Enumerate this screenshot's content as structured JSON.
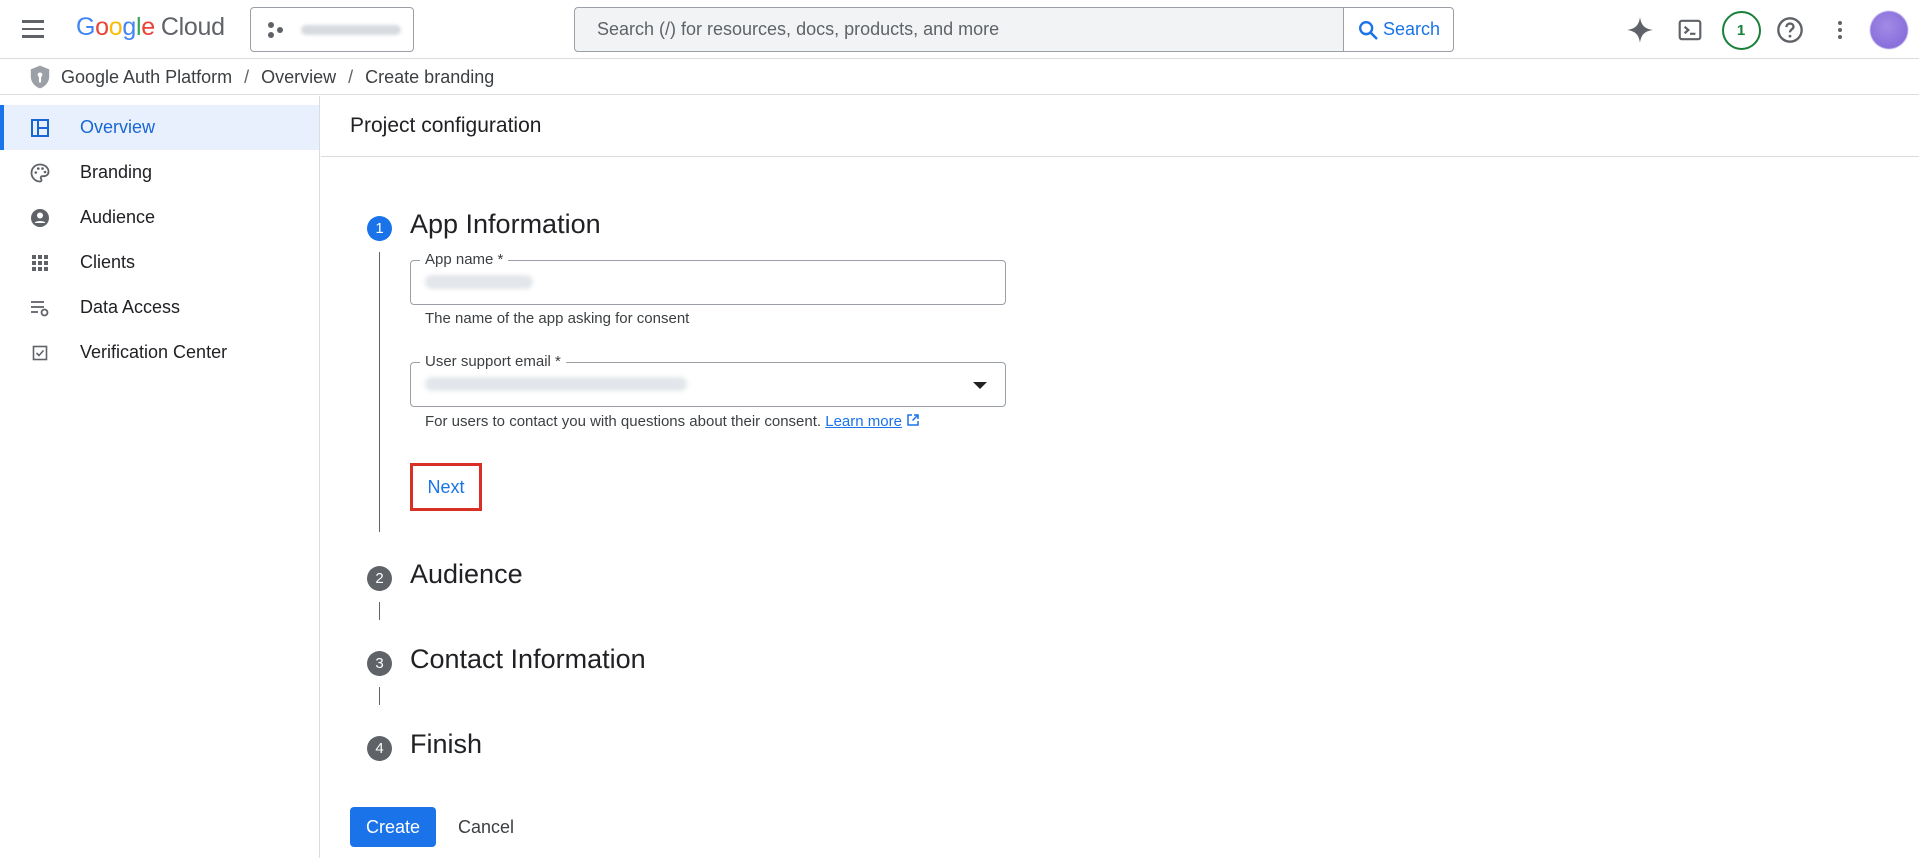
{
  "header": {
    "logo_google": [
      "G",
      "o",
      "o",
      "g",
      "l",
      "e"
    ],
    "logo_cloud": "Cloud",
    "search_placeholder": "Search (/) for resources, docs, products, and more",
    "search_button": "Search",
    "notifications_count": "1",
    "icons": [
      "menu-icon",
      "gemini-sparkle-icon",
      "cloud-shell-terminal-icon",
      "help-icon",
      "more-vert-icon"
    ]
  },
  "breadcrumb": {
    "items": [
      "Google Auth Platform",
      "Overview",
      "Create branding"
    ],
    "separator": "/"
  },
  "sidebar": {
    "items": [
      {
        "label": "Overview",
        "icon": "overview-dashboard-icon",
        "active": true
      },
      {
        "label": "Branding",
        "icon": "palette-icon",
        "active": false
      },
      {
        "label": "Audience",
        "icon": "account-circle-icon",
        "active": false
      },
      {
        "label": "Clients",
        "icon": "apps-grid-icon",
        "active": false
      },
      {
        "label": "Data Access",
        "icon": "data-access-list-icon",
        "active": false
      },
      {
        "label": "Verification Center",
        "icon": "checkbox-icon",
        "active": false
      }
    ]
  },
  "main": {
    "title": "Project configuration",
    "steps": [
      {
        "number": "1",
        "label": "App Information",
        "active": true
      },
      {
        "number": "2",
        "label": "Audience",
        "active": false
      },
      {
        "number": "3",
        "label": "Contact Information",
        "active": false
      },
      {
        "number": "4",
        "label": "Finish",
        "active": false
      }
    ],
    "app_name": {
      "label": "App name *",
      "hint": "The name of the app asking for consent"
    },
    "support_email": {
      "label": "User support email *",
      "hint": "For users to contact you with questions about their consent.",
      "learn_more": "Learn more"
    },
    "next_label": "Next",
    "create_label": "Create",
    "cancel_label": "Cancel"
  },
  "colors": {
    "accent": "#1a73e8",
    "highlight_border": "#d93025",
    "active_nav_bg": "#e8f0fe",
    "notification_green": "#188038"
  }
}
